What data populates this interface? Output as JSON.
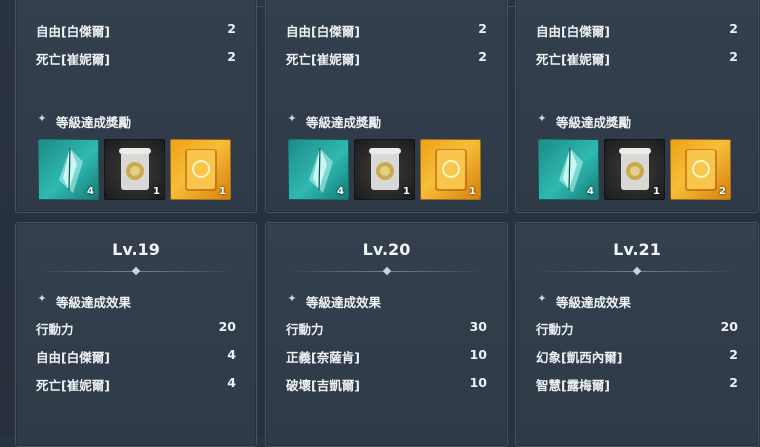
{
  "top_cards": [
    {
      "stats": [
        {
          "name": "自由[白傑爾]",
          "value": "2"
        },
        {
          "name": "死亡[崔妮爾]",
          "value": "2"
        }
      ],
      "section_title": "等級達成獎勵",
      "rewards": [
        {
          "icon": "crystal-fragment-icon",
          "qty": "4"
        },
        {
          "icon": "scroll-icon",
          "qty": "1"
        },
        {
          "icon": "golden-book-icon",
          "qty": "1"
        }
      ]
    },
    {
      "stats": [
        {
          "name": "自由[白傑爾]",
          "value": "2"
        },
        {
          "name": "死亡[崔妮爾]",
          "value": "2"
        }
      ],
      "section_title": "等級達成獎勵",
      "rewards": [
        {
          "icon": "crystal-fragment-icon",
          "qty": "4"
        },
        {
          "icon": "scroll-icon",
          "qty": "1"
        },
        {
          "icon": "golden-book-icon",
          "qty": "1"
        }
      ]
    },
    {
      "stats": [
        {
          "name": "自由[白傑爾]",
          "value": "2"
        },
        {
          "name": "死亡[崔妮爾]",
          "value": "2"
        }
      ],
      "section_title": "等級達成獎勵",
      "rewards": [
        {
          "icon": "crystal-fragment-icon",
          "qty": "4"
        },
        {
          "icon": "scroll-icon",
          "qty": "1"
        },
        {
          "icon": "golden-book-icon",
          "qty": "2"
        }
      ]
    }
  ],
  "bottom_cards": [
    {
      "level": "Lv.19",
      "section_title": "等級達成效果",
      "effects": [
        {
          "name": "行動力",
          "value": "20"
        },
        {
          "name": "自由[白傑爾]",
          "value": "4"
        },
        {
          "name": "死亡[崔妮爾]",
          "value": "4"
        }
      ]
    },
    {
      "level": "Lv.20",
      "section_title": "等級達成效果",
      "effects": [
        {
          "name": "行動力",
          "value": "30"
        },
        {
          "name": "正義[奈薩肯]",
          "value": "10"
        },
        {
          "name": "破壞[吉凱爾]",
          "value": "10"
        }
      ]
    },
    {
      "level": "Lv.21",
      "section_title": "等級達成效果",
      "effects": [
        {
          "name": "行動力",
          "value": "20"
        },
        {
          "name": "幻象[凱西內爾]",
          "value": "2"
        },
        {
          "name": "智慧[露梅爾]",
          "value": "2"
        }
      ]
    }
  ],
  "colors": {
    "background": "#2a3340",
    "card": "#34404e",
    "teal_item": "#2fb9b0",
    "orange_item": "#f6be3a"
  }
}
